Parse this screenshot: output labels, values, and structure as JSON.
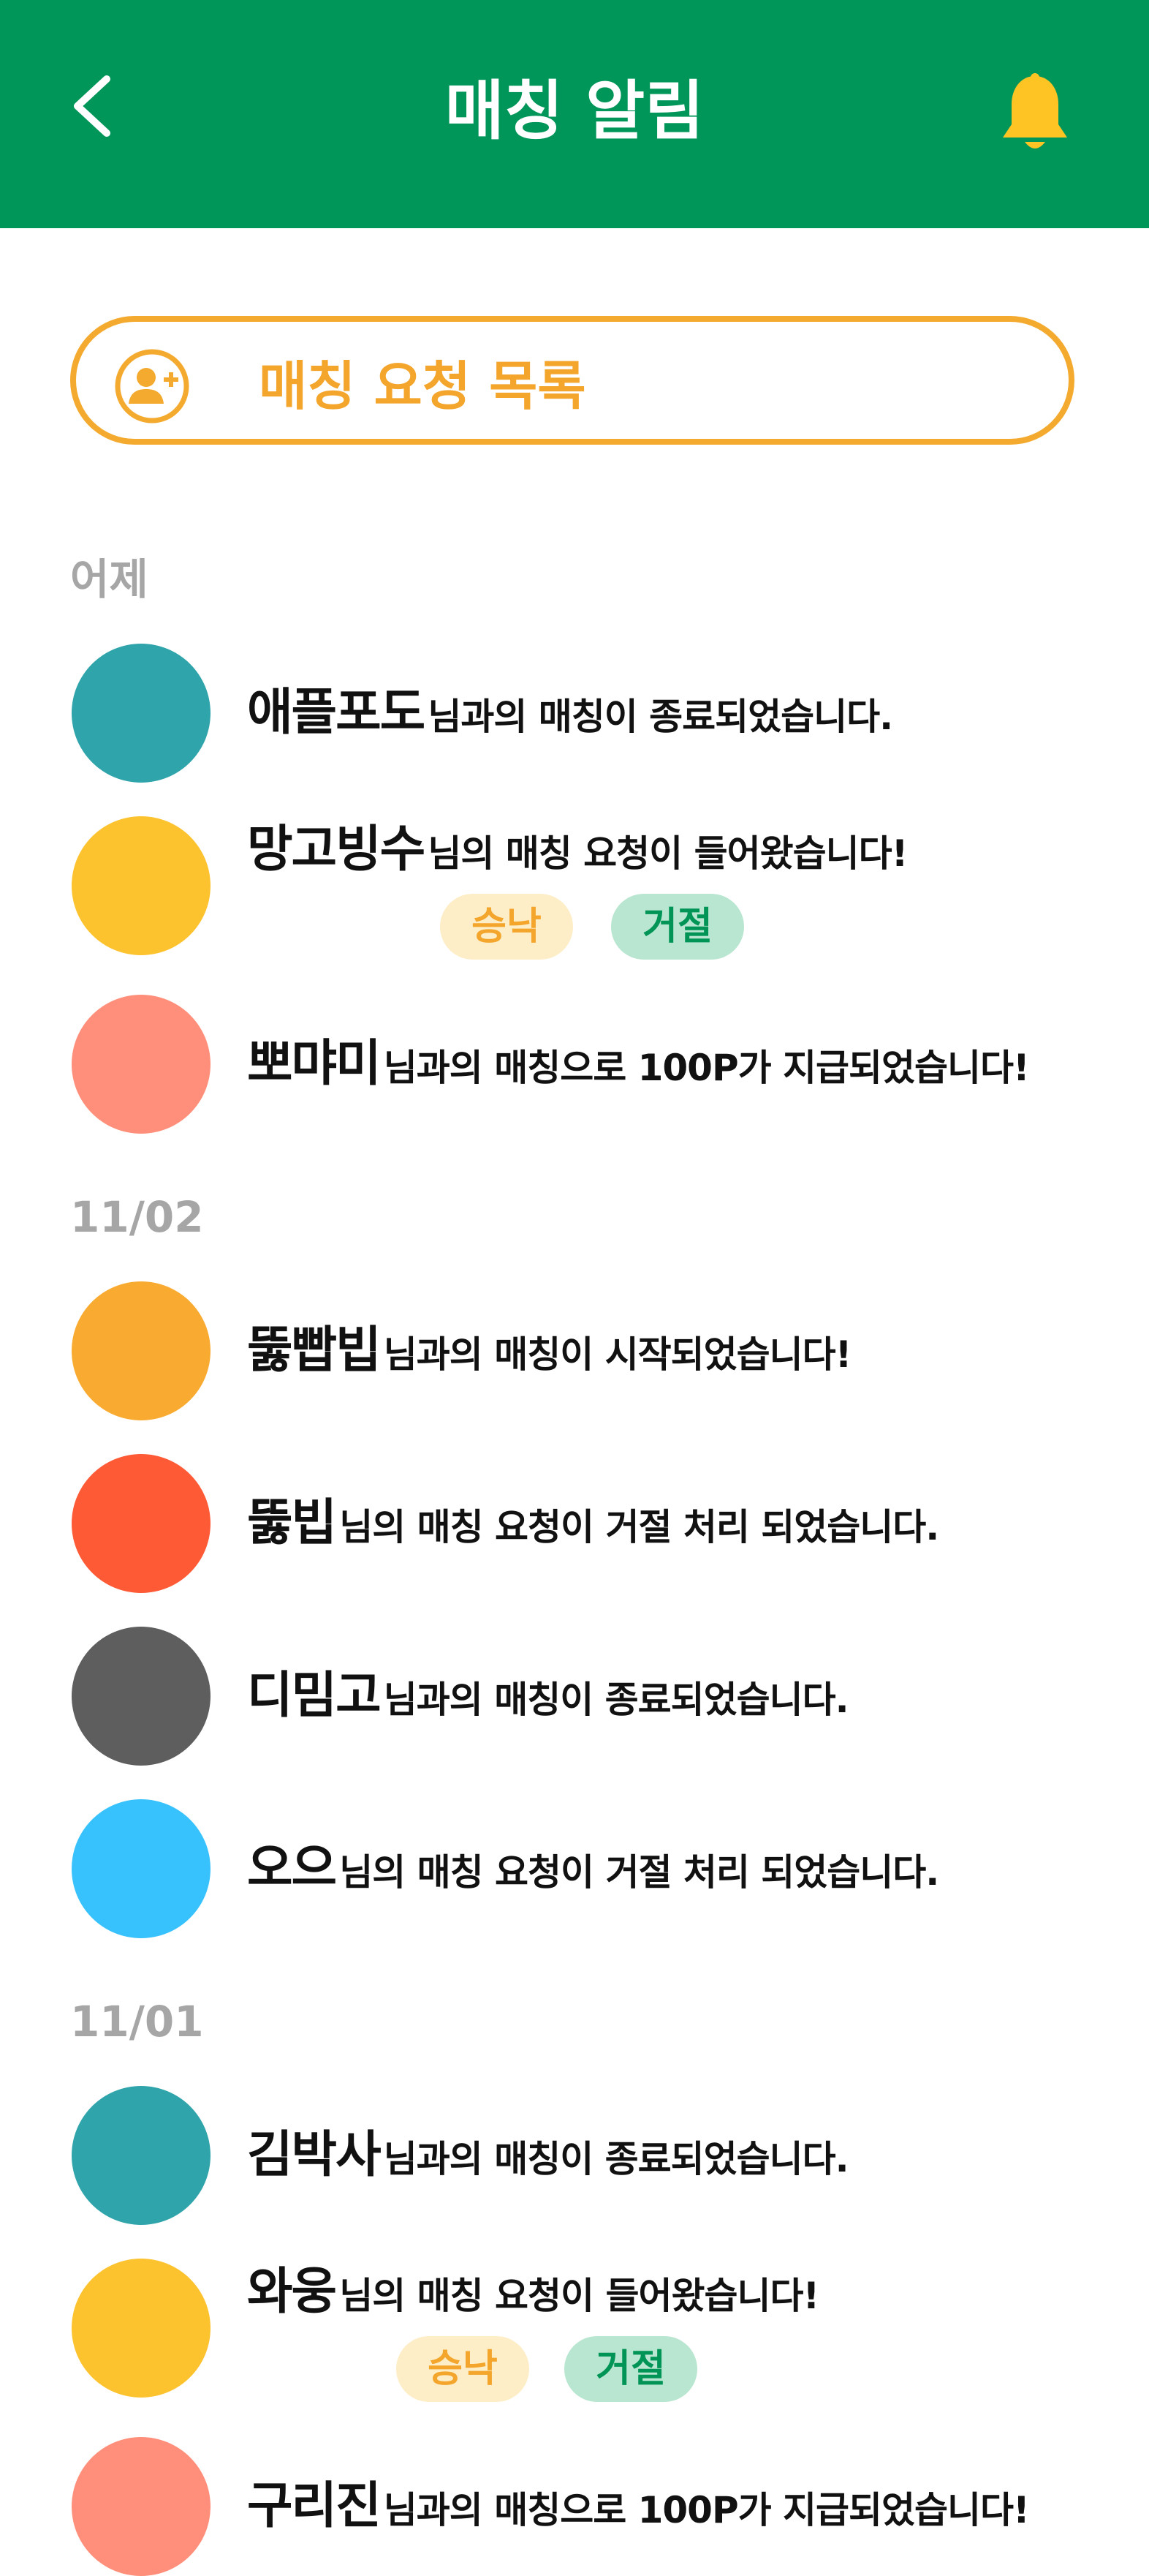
{
  "header": {
    "title": "매칭 알림",
    "background_color": "#00965a",
    "back_icon": "chevron-left-icon",
    "bell_icon": "bell-icon",
    "bell_color": "#fdc423"
  },
  "request_button": {
    "label": "매칭 요청 목록",
    "icon": "person-add-icon",
    "accent_color": "#f4aa2e"
  },
  "sections": [
    {
      "label": "어제",
      "items": [
        {
          "nickname": "애플포도",
          "message": "님과의 매칭이 종료되었습니다.",
          "avatar_color": "#2fa4ab"
        },
        {
          "nickname": "망고빙수",
          "message": "님의 매칭 요청이 들어왔습니다!",
          "avatar_color": "#fdc32f",
          "accept_label": "승낙",
          "reject_label": "거절"
        },
        {
          "nickname": "뽀먀미",
          "message": "님과의 매칭으로 100P가 지급되었습니다!",
          "avatar_color": "#ff8f7a"
        }
      ]
    },
    {
      "label": "11/02",
      "items": [
        {
          "nickname": "뚫빱빕",
          "message": "님과의 매칭이 시작되었습니다!",
          "avatar_color": "#f9aa30"
        },
        {
          "nickname": "뚫빕",
          "message": "님의 매칭 요청이 거절 처리 되었습니다.",
          "avatar_color": "#ff5a36"
        },
        {
          "nickname": "디밈고",
          "message": "님과의 매칭이 종료되었습니다.",
          "avatar_color": "#5e5e5e"
        },
        {
          "nickname": "오으",
          "message": "님의 매칭 요청이 거절 처리 되었습니다.",
          "avatar_color": "#38c2fd"
        }
      ]
    },
    {
      "label": "11/01",
      "items": [
        {
          "nickname": "김박사",
          "message": "님과의 매칭이 종료되었습니다.",
          "avatar_color": "#2fa4ab"
        },
        {
          "nickname": "와웅",
          "message": "님의 매칭 요청이 들어왔습니다!",
          "avatar_color": "#fdc32f",
          "accept_label": "승낙",
          "reject_label": "거절"
        },
        {
          "nickname": "구리진",
          "message": "님과의 매칭으로 100P가 지급되었습니다!",
          "avatar_color": "#ff8f7a"
        }
      ]
    }
  ]
}
